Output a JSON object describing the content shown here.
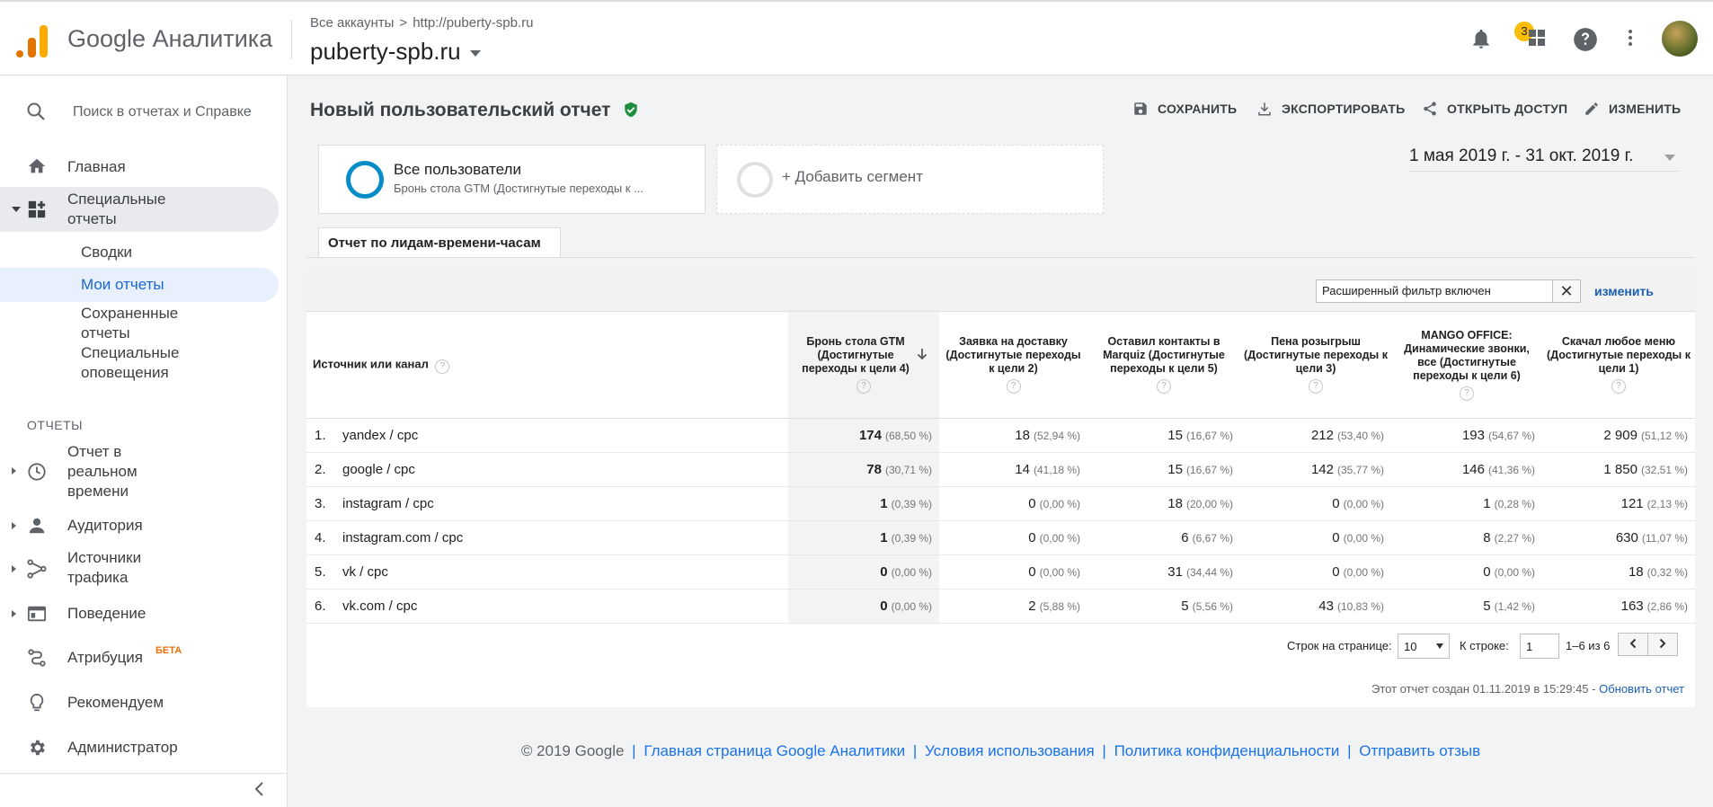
{
  "header": {
    "brand": "Google Аналитика",
    "crumb_root": "Все аккаунты",
    "crumb_sep": ">",
    "crumb_site": "http://puberty-spb.ru",
    "property": "puberty-spb.ru",
    "notifications_count": "3"
  },
  "sidebar": {
    "search_placeholder": "Поиск в отчетах и Справке",
    "home": "Главная",
    "custom_reports": "Специальные отчеты",
    "summaries": "Сводки",
    "my_reports": "Мои отчеты",
    "saved_reports": "Сохраненные отчеты",
    "custom_alerts": "Специальные оповещения",
    "section_reports": "ОТЧЕТЫ",
    "realtime": "Отчет в реальном времени",
    "audience": "Аудитория",
    "acquisition": "Источники трафика",
    "behavior": "Поведение",
    "attribution": "Атрибуция",
    "attribution_badge": "БЕТА",
    "discover": "Рекомендуем",
    "admin": "Администратор"
  },
  "report": {
    "title": "Новый пользовательский отчет",
    "save": "СОХРАНИТЬ",
    "export": "ЭКСПОРТИРОВАТЬ",
    "share": "ОТКРЫТЬ ДОСТУП",
    "edit": "ИЗМЕНИТЬ",
    "segment_name": "Все пользователи",
    "segment_desc": "Бронь стола GTM (Достигнутые переходы к ...",
    "add_segment": "+ Добавить сегмент",
    "date_range": "1 мая 2019 г. - 31 окт. 2019 г.",
    "tab": "Отчет по лидам-времени-часам",
    "filter_text": "Расширенный фильтр включен",
    "filter_edit": "изменить"
  },
  "table": {
    "dimension_header": "Источник или канал",
    "columns": [
      "Бронь стола GTM (Достигнутые переходы к цели 4)",
      "Заявка на доставку (Достигнутые переходы к цели 2)",
      "Оставил контакты в Marquiz (Достигнутые переходы к цели 5)",
      "Пена розыгрыш (Достигнутые переходы к цели 3)",
      "MANGO OFFICE: Динамические звонки, все (Достигнутые переходы к цели 6)",
      "Скачал любое меню (Достигнутые переходы к цели 1)"
    ],
    "rows": [
      {
        "idx": "1.",
        "source": "yandex / cpc",
        "cells": [
          [
            "174",
            "(68,50 %)"
          ],
          [
            "18",
            "(52,94 %)"
          ],
          [
            "15",
            "(16,67 %)"
          ],
          [
            "212",
            "(53,40 %)"
          ],
          [
            "193",
            "(54,67 %)"
          ],
          [
            "2 909",
            "(51,12 %)"
          ]
        ]
      },
      {
        "idx": "2.",
        "source": "google / cpc",
        "cells": [
          [
            "78",
            "(30,71 %)"
          ],
          [
            "14",
            "(41,18 %)"
          ],
          [
            "15",
            "(16,67 %)"
          ],
          [
            "142",
            "(35,77 %)"
          ],
          [
            "146",
            "(41,36 %)"
          ],
          [
            "1 850",
            "(32,51 %)"
          ]
        ]
      },
      {
        "idx": "3.",
        "source": "instagram / cpc",
        "cells": [
          [
            "1",
            "(0,39 %)"
          ],
          [
            "0",
            "(0,00 %)"
          ],
          [
            "18",
            "(20,00 %)"
          ],
          [
            "0",
            "(0,00 %)"
          ],
          [
            "1",
            "(0,28 %)"
          ],
          [
            "121",
            "(2,13 %)"
          ]
        ]
      },
      {
        "idx": "4.",
        "source": "instagram.com / cpc",
        "cells": [
          [
            "1",
            "(0,39 %)"
          ],
          [
            "0",
            "(0,00 %)"
          ],
          [
            "6",
            "(6,67 %)"
          ],
          [
            "0",
            "(0,00 %)"
          ],
          [
            "8",
            "(2,27 %)"
          ],
          [
            "630",
            "(11,07 %)"
          ]
        ]
      },
      {
        "idx": "5.",
        "source": "vk / cpc",
        "cells": [
          [
            "0",
            "(0,00 %)"
          ],
          [
            "0",
            "(0,00 %)"
          ],
          [
            "31",
            "(34,44 %)"
          ],
          [
            "0",
            "(0,00 %)"
          ],
          [
            "0",
            "(0,00 %)"
          ],
          [
            "18",
            "(0,32 %)"
          ]
        ]
      },
      {
        "idx": "6.",
        "source": "vk.com / cpc",
        "cells": [
          [
            "0",
            "(0,00 %)"
          ],
          [
            "2",
            "(5,88 %)"
          ],
          [
            "5",
            "(5,56 %)"
          ],
          [
            "43",
            "(10,83 %)"
          ],
          [
            "5",
            "(1,42 %)"
          ],
          [
            "163",
            "(2,86 %)"
          ]
        ]
      }
    ]
  },
  "pagination": {
    "rows_label": "Строк на странице:",
    "rows_value": "10",
    "goto_label": "К строке:",
    "goto_value": "1",
    "range": "1–6 из 6"
  },
  "created": {
    "text": "Этот отчет создан 01.11.2019 в 15:29:45 -",
    "refresh": "Обновить отчет"
  },
  "footer": {
    "copyright": "© 2019 Google",
    "home": "Главная страница Google Аналитики",
    "terms": "Условия использования",
    "privacy": "Политика конфиденциальности",
    "feedback": "Отправить отзыв"
  },
  "colors": {
    "segment_ring": "#058dc7",
    "accent": "#1a73e8",
    "badge": "#fbbc04",
    "verified": "#1e8e3e"
  }
}
